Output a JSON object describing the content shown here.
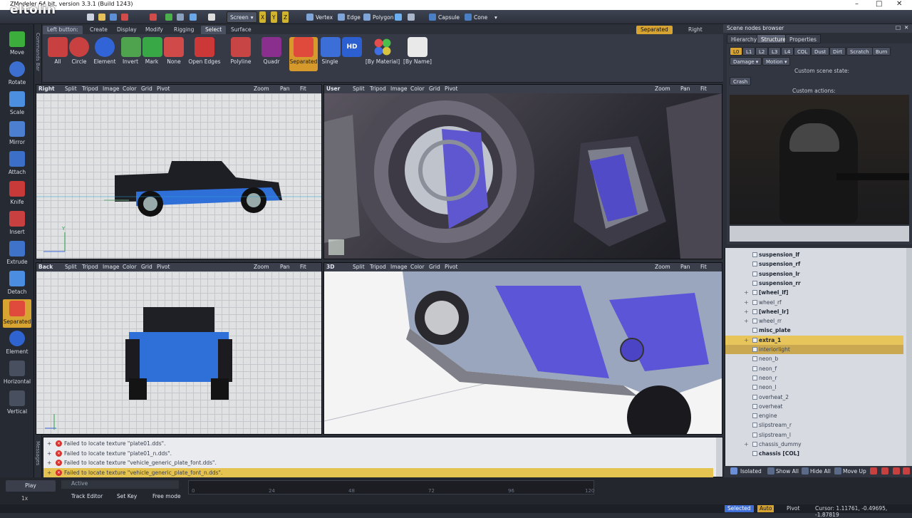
{
  "window": {
    "title": "ZModeler 64 bit, version 3.3.1 (Build 1243)",
    "watermark": "eltolin"
  },
  "toolbar": {
    "screen": "Screen",
    "vertex": "Vertex",
    "edge": "Edge",
    "polygon": "Polygon",
    "capsule": "Capsule",
    "cone": "Cone"
  },
  "left_tools": [
    "Move",
    "Rotate",
    "Scale",
    "Mirror",
    "Attach",
    "Knife",
    "Insert",
    "Extrude",
    "Detach",
    "Separated",
    "Element",
    "Horizontal",
    "Vertical"
  ],
  "left_vertical_tab": "Commands Bar",
  "message_vertical_tab": "Messages",
  "command_tabs": {
    "left_button": "Left button:",
    "tabs": [
      "Create",
      "Display",
      "Modify",
      "Rigging",
      "Select",
      "Surface"
    ],
    "active": "Select"
  },
  "command_buttons": [
    "All",
    "Circle",
    "Element",
    "Invert",
    "Mark",
    "None",
    "Open Edges",
    "Polyline",
    "Quadr",
    "Separated",
    "Single",
    "HD",
    "[By Material]",
    "[By Name]"
  ],
  "right_button": {
    "mode": "Separated",
    "label": "Right button:"
  },
  "viewports": {
    "right": {
      "name": "Right",
      "menu": [
        "Split",
        "Tripod",
        "Image",
        "Color",
        "Grid",
        "Pivot"
      ],
      "zoom": "Zoom",
      "pan": "Pan",
      "fit": "Fit"
    },
    "user": {
      "name": "User",
      "menu": [
        "Split",
        "Tripod",
        "Image",
        "Color",
        "Grid",
        "Pivot"
      ],
      "zoom": "Zoom",
      "pan": "Pan",
      "fit": "Fit"
    },
    "back": {
      "name": "Back",
      "menu": [
        "Split",
        "Tripod",
        "Image",
        "Color",
        "Grid",
        "Pivot"
      ],
      "zoom": "Zoom",
      "pan": "Pan",
      "fit": "Fit"
    },
    "threed": {
      "name": "3D",
      "menu": [
        "Split",
        "Tripod",
        "Image",
        "Color",
        "Grid",
        "Pivot"
      ],
      "zoom": "Zoom",
      "pan": "Pan",
      "fit": "Fit"
    }
  },
  "axes": {
    "y": "Y",
    "z": "Z"
  },
  "scene_browser": {
    "title": "Scene nodes browser",
    "tabs": [
      "Hierarchy",
      "Structure",
      "Properties"
    ],
    "active_tab": "Structure",
    "lods": [
      "L0",
      "L1",
      "L2",
      "L3",
      "L4",
      "COL",
      "Dust",
      "Dirt",
      "Scratch",
      "Burn"
    ],
    "damage": "Damage",
    "motion": "Motion",
    "custom_state": "Custom scene state:",
    "crash": "Crash",
    "custom_actions": "Custom actions:"
  },
  "tree": [
    {
      "label": "suspension_lf",
      "bold": true,
      "expand": false
    },
    {
      "label": "suspension_rf",
      "bold": true,
      "expand": false
    },
    {
      "label": "suspension_lr",
      "bold": true,
      "expand": false
    },
    {
      "label": "suspension_rr",
      "bold": true,
      "expand": false
    },
    {
      "label": "[wheel_lf]",
      "bold": true,
      "expand": true
    },
    {
      "label": "wheel_rf",
      "bold": false,
      "expand": true
    },
    {
      "label": "[wheel_lr]",
      "bold": true,
      "expand": true
    },
    {
      "label": "wheel_rr",
      "bold": false,
      "expand": true
    },
    {
      "label": "misc_plate",
      "bold": true,
      "expand": false
    },
    {
      "label": "extra_1",
      "bold": true,
      "expand": true,
      "selected": true
    },
    {
      "label": "interiorlight",
      "bold": false,
      "expand": false,
      "selected2": true
    },
    {
      "label": "neon_b",
      "bold": false,
      "expand": false
    },
    {
      "label": "neon_f",
      "bold": false,
      "expand": false
    },
    {
      "label": "neon_r",
      "bold": false,
      "expand": false
    },
    {
      "label": "neon_l",
      "bold": false,
      "expand": false
    },
    {
      "label": "overheat_2",
      "bold": false,
      "expand": false
    },
    {
      "label": "overheat",
      "bold": false,
      "expand": false
    },
    {
      "label": "engine",
      "bold": false,
      "expand": false
    },
    {
      "label": "slipstream_r",
      "bold": false,
      "expand": false
    },
    {
      "label": "slipstream_l",
      "bold": false,
      "expand": false
    },
    {
      "label": "chassis_dummy",
      "bold": false,
      "expand": true
    },
    {
      "label": "chassis [COL]",
      "bold": true,
      "expand": false
    }
  ],
  "tree_bar": {
    "isolated": "Isolated",
    "show_all": "Show All",
    "hide_all": "Hide All",
    "move_up": "Move Up"
  },
  "log": [
    "Failed to locate texture \"plate01.dds\".",
    "Failed to locate texture \"plate01_n.dds\".",
    "Failed to locate texture \"vehicle_generic_plate_font.dds\".",
    "Failed to locate texture \"vehicle_generic_plate_font_n.dds\"."
  ],
  "timeline": {
    "play": "Play",
    "active": "Active",
    "speed": "1x",
    "track_editor": "Track Editor",
    "set_key": "Set Key",
    "free_mode": "Free mode",
    "ticks": [
      "0",
      "24",
      "48",
      "72",
      "96",
      "120"
    ]
  },
  "status": {
    "selected": "Selected",
    "auto": "Auto",
    "pivot": "Pivot",
    "cursor": "Cursor: 1.11761, -0.49695, -1.87819"
  },
  "colors": {
    "accent": "#d8a431",
    "error": "#d6332d",
    "truck_blue": "#2f6fd8"
  }
}
